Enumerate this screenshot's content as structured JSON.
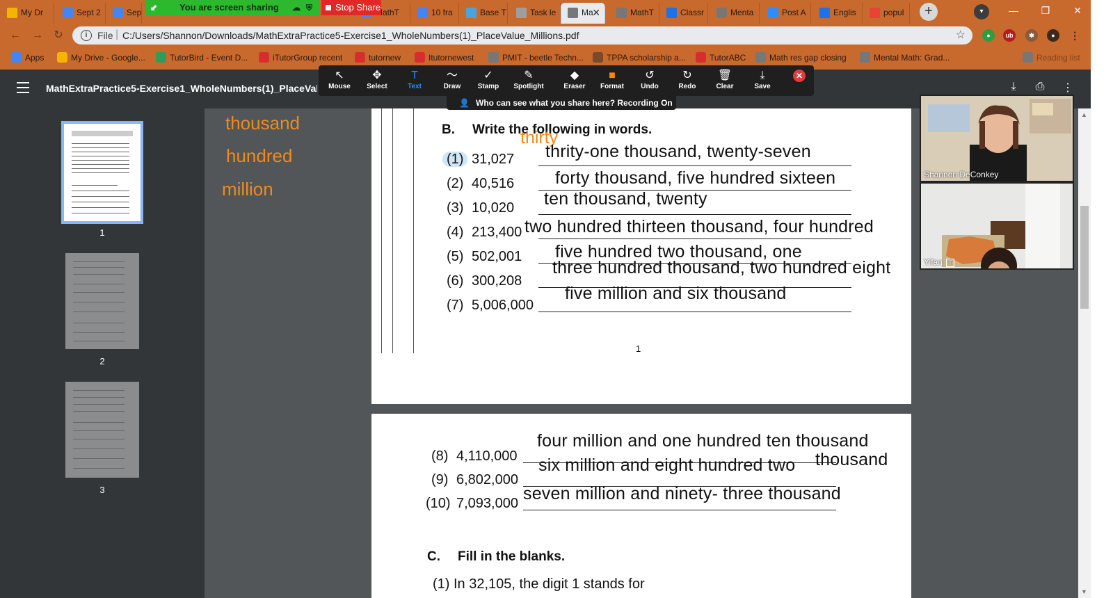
{
  "tabs": [
    {
      "label": "My Dr",
      "icon": "drive-icon",
      "color": "#f4b400"
    },
    {
      "label": "Sept 2",
      "icon": "docs-icon",
      "color": "#4285f4"
    },
    {
      "label": "Sept",
      "icon": "docs-icon",
      "color": "#4285f4"
    },
    {
      "label": "MathT",
      "icon": "docs-icon",
      "color": "#4285f4"
    },
    {
      "label": "10 fra",
      "icon": "docs-icon",
      "color": "#4285f4"
    },
    {
      "label": "Base T",
      "icon": "bot-icon",
      "color": "#4aa3df"
    },
    {
      "label": "Task le",
      "icon": "doc-icon",
      "color": "#9e9e9e"
    },
    {
      "label": "Ma",
      "icon": "globe-icon",
      "color": "#777777",
      "active": true
    },
    {
      "label": "MathT",
      "icon": "globe-icon",
      "color": "#777777"
    },
    {
      "label": "Classr",
      "icon": "classroom-icon",
      "color": "#1a73e8"
    },
    {
      "label": "Menta",
      "icon": "globe-icon",
      "color": "#777777"
    },
    {
      "label": "Post A",
      "icon": "zoom-icon",
      "color": "#2d8cff"
    },
    {
      "label": "Englis",
      "icon": "classroom-icon",
      "color": "#1a73e8"
    },
    {
      "label": "popul",
      "icon": "google-icon",
      "color": "#ea4335"
    }
  ],
  "sharing": {
    "banner": "You are screen sharing",
    "stop": "Stop Share"
  },
  "address": {
    "scheme": "File",
    "url": "C:/Users/Shannon/Downloads/MathExtraPractice5-Exercise1_WholeNumbers(1)_PlaceValue_Millions.pdf"
  },
  "bookmarks": [
    {
      "label": "Apps",
      "icon": "apps-icon",
      "color": "#4285f4"
    },
    {
      "label": "My Drive - Google...",
      "icon": "drive-icon",
      "color": "#f4b400"
    },
    {
      "label": "TutorBird - Event D...",
      "icon": "tutorbird-icon",
      "color": "#2e9d5b"
    },
    {
      "label": "iTutorGroup recent",
      "icon": "itutor-icon",
      "color": "#d62e2e"
    },
    {
      "label": "tutornew",
      "icon": "itutor-icon",
      "color": "#d62e2e"
    },
    {
      "label": "Itutornewest",
      "icon": "itutor-icon",
      "color": "#d62e2e"
    },
    {
      "label": "PMIT - beetle Techn...",
      "icon": "globe-icon",
      "color": "#777777"
    },
    {
      "label": "TPPA scholarship a...",
      "icon": "seal-icon",
      "color": "#7a4a2a"
    },
    {
      "label": "TutorABC",
      "icon": "itutor-icon",
      "color": "#d62e2e"
    },
    {
      "label": "Math res gap closing",
      "icon": "globe-icon",
      "color": "#777777"
    },
    {
      "label": "Mental Math: Grad...",
      "icon": "globe-icon",
      "color": "#777777"
    },
    {
      "label": "Reading list",
      "icon": "reading-list-icon",
      "color": "#777777",
      "faded": true
    }
  ],
  "pdf": {
    "title": "MathExtraPractice5-Exercise1_WholeNumbers(1)_PlaceValue_Millions.pdf"
  },
  "annotate_tools": [
    {
      "name": "mouse",
      "label": "Mouse",
      "glyph": "↖"
    },
    {
      "name": "select",
      "label": "Select",
      "glyph": "✥"
    },
    {
      "name": "text",
      "label": "Text",
      "glyph": "T",
      "active": true
    },
    {
      "name": "draw",
      "label": "Draw",
      "glyph": "〜"
    },
    {
      "name": "stamp",
      "label": "Stamp",
      "glyph": "✓"
    },
    {
      "name": "spotlight",
      "label": "Spotlight",
      "glyph": "✎"
    },
    {
      "name": "eraser",
      "label": "Eraser",
      "glyph": "◆"
    },
    {
      "name": "format",
      "label": "Format",
      "glyph": "■"
    },
    {
      "name": "undo",
      "label": "Undo",
      "glyph": "↺"
    },
    {
      "name": "redo",
      "label": "Redo",
      "glyph": "↻"
    },
    {
      "name": "clear",
      "label": "Clear",
      "glyph": "🗑"
    },
    {
      "name": "save",
      "label": "Save",
      "glyph": "⤓"
    }
  ],
  "who_can_see": "Who can see what you share here? Recording On",
  "thumbnails": [
    {
      "label": "1",
      "selected": true
    },
    {
      "label": "2"
    },
    {
      "label": "3"
    }
  ],
  "side_words": [
    "thousand",
    "hundred",
    "million"
  ],
  "section_b": {
    "letter": "B.",
    "title": "Write the following in words."
  },
  "annotation_thirty": "thirty",
  "items_page1": [
    {
      "num": "(1)",
      "value": "31,027",
      "answer": "thrity-one thousand, twenty-seven"
    },
    {
      "num": "(2)",
      "value": "40,516",
      "answer": "forty thousand, five hundred sixteen"
    },
    {
      "num": "(3)",
      "value": "10,020",
      "answer": "ten thousand, twenty"
    },
    {
      "num": "(4)",
      "value": "213,400",
      "answer": "two hundred thirteen thousand, four hundred"
    },
    {
      "num": "(5)",
      "value": "502,001",
      "answer": "five hundred two thousand, one"
    },
    {
      "num": "(6)",
      "value": "300,208",
      "answer": "three hundred thousand, two hundred eight"
    },
    {
      "num": "(7)",
      "value": "5,006,000",
      "answer": "five million and six thousand"
    }
  ],
  "page_number": "1",
  "items_page2": [
    {
      "num": "(8)",
      "value": "4,110,000",
      "answer": "four million and one hundred ten thousand"
    },
    {
      "num": "(9)",
      "value": "6,802,000",
      "answer": "six million and eight hundred two"
    },
    {
      "num": "(10)",
      "value": "7,093,000",
      "answer": "seven million and ninety- three thousand"
    }
  ],
  "extra_thousand": "thousand",
  "section_c": {
    "letter": "C.",
    "title": "Fill in the blanks."
  },
  "section_c_partial": "(1)  In 32,105, the digit 1 stands for",
  "participants": [
    {
      "name": "Shannon DeConkey"
    },
    {
      "name": "Yifan"
    }
  ]
}
